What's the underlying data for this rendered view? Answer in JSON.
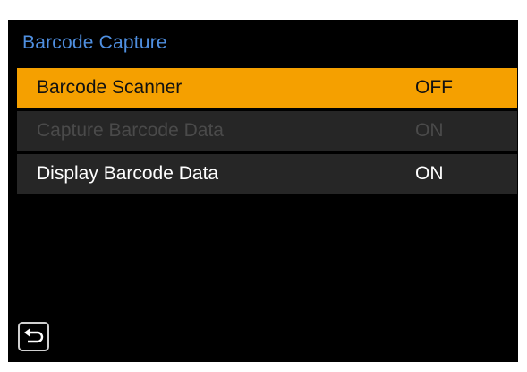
{
  "menu": {
    "title": "Barcode Capture",
    "items": [
      {
        "label": "Barcode Scanner",
        "value": "OFF",
        "state": "selected"
      },
      {
        "label": "Capture Barcode Data",
        "value": "ON",
        "state": "disabled"
      },
      {
        "label": "Display Barcode Data",
        "value": "ON",
        "state": "normal"
      }
    ]
  },
  "icons": {
    "back": "return-arrow-icon"
  },
  "colors": {
    "title": "#4f8fe0",
    "selected_row": "#f5a000",
    "row_background": "#262626",
    "disabled_text": "#4a4a4a"
  }
}
